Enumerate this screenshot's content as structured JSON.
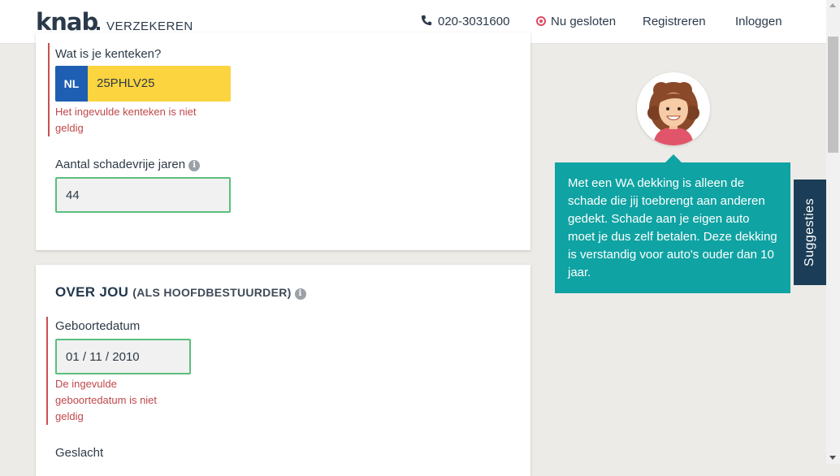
{
  "header": {
    "logo": "knab",
    "logo_sub": "VERZEKEREN",
    "phone": "020-3031600",
    "status": "Nu gesloten",
    "register": "Registreren",
    "login": "Inloggen"
  },
  "vehicle": {
    "plate_label": "Wat is je kenteken?",
    "plate_country": "NL",
    "plate_value": "25PHLV25",
    "plate_error_line1": "Het ingevulde kenteken is niet",
    "plate_error_line2": "geldig",
    "years_label": "Aantal schadevrije jaren",
    "years_value": "44"
  },
  "about": {
    "title": "OVER JOU",
    "subtitle": "(ALS HOOFDBESTUURDER)",
    "birth_label": "Geboortedatum",
    "birth_value": "01 / 11 / 2010",
    "birth_error_line1": "De ingevulde",
    "birth_error_line2": "geboortedatum is niet",
    "birth_error_line3": "geldig",
    "gender_label": "Geslacht"
  },
  "advisor": {
    "message": "Met een WA dekking is alleen de schade die jij toebrengt aan anderen gedekt. Schade aan je eigen auto moet je dus zelf betalen. Deze dekking is verstandig voor auto's ouder dan 10 jaar."
  },
  "suggestions_tab": "Suggesties",
  "colors": {
    "accent_teal": "#10a3a3",
    "navy": "#1b3d57",
    "error": "#c0474a",
    "plate_yellow": "#fbd43f",
    "plate_blue": "#1e5fb3",
    "valid_border": "#5bbf7d"
  }
}
